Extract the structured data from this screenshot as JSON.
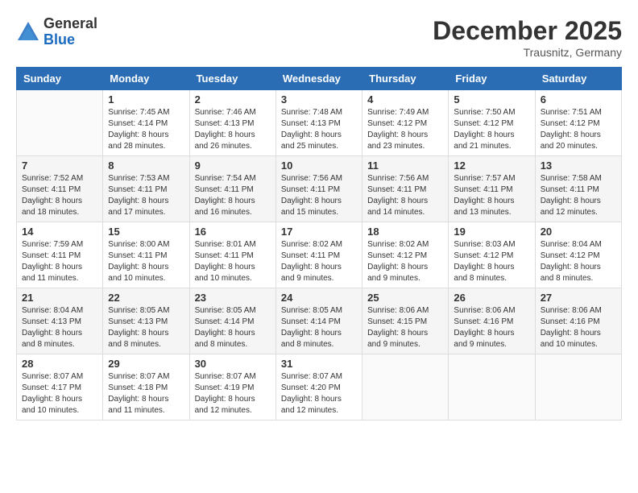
{
  "header": {
    "logo_general": "General",
    "logo_blue": "Blue",
    "month_title": "December 2025",
    "location": "Trausnitz, Germany"
  },
  "weekdays": [
    "Sunday",
    "Monday",
    "Tuesday",
    "Wednesday",
    "Thursday",
    "Friday",
    "Saturday"
  ],
  "weeks": [
    [
      {
        "day": "",
        "info": ""
      },
      {
        "day": "1",
        "info": "Sunrise: 7:45 AM\nSunset: 4:14 PM\nDaylight: 8 hours\nand 28 minutes."
      },
      {
        "day": "2",
        "info": "Sunrise: 7:46 AM\nSunset: 4:13 PM\nDaylight: 8 hours\nand 26 minutes."
      },
      {
        "day": "3",
        "info": "Sunrise: 7:48 AM\nSunset: 4:13 PM\nDaylight: 8 hours\nand 25 minutes."
      },
      {
        "day": "4",
        "info": "Sunrise: 7:49 AM\nSunset: 4:12 PM\nDaylight: 8 hours\nand 23 minutes."
      },
      {
        "day": "5",
        "info": "Sunrise: 7:50 AM\nSunset: 4:12 PM\nDaylight: 8 hours\nand 21 minutes."
      },
      {
        "day": "6",
        "info": "Sunrise: 7:51 AM\nSunset: 4:12 PM\nDaylight: 8 hours\nand 20 minutes."
      }
    ],
    [
      {
        "day": "7",
        "info": "Sunrise: 7:52 AM\nSunset: 4:11 PM\nDaylight: 8 hours\nand 18 minutes."
      },
      {
        "day": "8",
        "info": "Sunrise: 7:53 AM\nSunset: 4:11 PM\nDaylight: 8 hours\nand 17 minutes."
      },
      {
        "day": "9",
        "info": "Sunrise: 7:54 AM\nSunset: 4:11 PM\nDaylight: 8 hours\nand 16 minutes."
      },
      {
        "day": "10",
        "info": "Sunrise: 7:56 AM\nSunset: 4:11 PM\nDaylight: 8 hours\nand 15 minutes."
      },
      {
        "day": "11",
        "info": "Sunrise: 7:56 AM\nSunset: 4:11 PM\nDaylight: 8 hours\nand 14 minutes."
      },
      {
        "day": "12",
        "info": "Sunrise: 7:57 AM\nSunset: 4:11 PM\nDaylight: 8 hours\nand 13 minutes."
      },
      {
        "day": "13",
        "info": "Sunrise: 7:58 AM\nSunset: 4:11 PM\nDaylight: 8 hours\nand 12 minutes."
      }
    ],
    [
      {
        "day": "14",
        "info": "Sunrise: 7:59 AM\nSunset: 4:11 PM\nDaylight: 8 hours\nand 11 minutes."
      },
      {
        "day": "15",
        "info": "Sunrise: 8:00 AM\nSunset: 4:11 PM\nDaylight: 8 hours\nand 10 minutes."
      },
      {
        "day": "16",
        "info": "Sunrise: 8:01 AM\nSunset: 4:11 PM\nDaylight: 8 hours\nand 10 minutes."
      },
      {
        "day": "17",
        "info": "Sunrise: 8:02 AM\nSunset: 4:11 PM\nDaylight: 8 hours\nand 9 minutes."
      },
      {
        "day": "18",
        "info": "Sunrise: 8:02 AM\nSunset: 4:12 PM\nDaylight: 8 hours\nand 9 minutes."
      },
      {
        "day": "19",
        "info": "Sunrise: 8:03 AM\nSunset: 4:12 PM\nDaylight: 8 hours\nand 8 minutes."
      },
      {
        "day": "20",
        "info": "Sunrise: 8:04 AM\nSunset: 4:12 PM\nDaylight: 8 hours\nand 8 minutes."
      }
    ],
    [
      {
        "day": "21",
        "info": "Sunrise: 8:04 AM\nSunset: 4:13 PM\nDaylight: 8 hours\nand 8 minutes."
      },
      {
        "day": "22",
        "info": "Sunrise: 8:05 AM\nSunset: 4:13 PM\nDaylight: 8 hours\nand 8 minutes."
      },
      {
        "day": "23",
        "info": "Sunrise: 8:05 AM\nSunset: 4:14 PM\nDaylight: 8 hours\nand 8 minutes."
      },
      {
        "day": "24",
        "info": "Sunrise: 8:05 AM\nSunset: 4:14 PM\nDaylight: 8 hours\nand 8 minutes."
      },
      {
        "day": "25",
        "info": "Sunrise: 8:06 AM\nSunset: 4:15 PM\nDaylight: 8 hours\nand 9 minutes."
      },
      {
        "day": "26",
        "info": "Sunrise: 8:06 AM\nSunset: 4:16 PM\nDaylight: 8 hours\nand 9 minutes."
      },
      {
        "day": "27",
        "info": "Sunrise: 8:06 AM\nSunset: 4:16 PM\nDaylight: 8 hours\nand 10 minutes."
      }
    ],
    [
      {
        "day": "28",
        "info": "Sunrise: 8:07 AM\nSunset: 4:17 PM\nDaylight: 8 hours\nand 10 minutes."
      },
      {
        "day": "29",
        "info": "Sunrise: 8:07 AM\nSunset: 4:18 PM\nDaylight: 8 hours\nand 11 minutes."
      },
      {
        "day": "30",
        "info": "Sunrise: 8:07 AM\nSunset: 4:19 PM\nDaylight: 8 hours\nand 12 minutes."
      },
      {
        "day": "31",
        "info": "Sunrise: 8:07 AM\nSunset: 4:20 PM\nDaylight: 8 hours\nand 12 minutes."
      },
      {
        "day": "",
        "info": ""
      },
      {
        "day": "",
        "info": ""
      },
      {
        "day": "",
        "info": ""
      }
    ]
  ]
}
